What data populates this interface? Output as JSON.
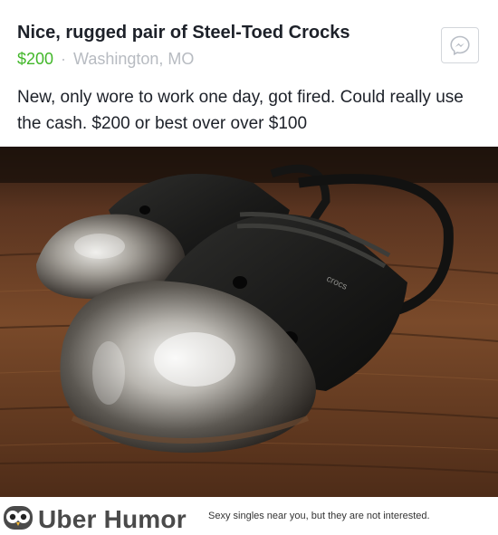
{
  "post": {
    "title": "Nice, rugged pair of Steel-Toed Crocks",
    "price": "$200",
    "separator": "·",
    "location": "Washington, MO",
    "description": "New, only wore to work one day, got fired. Could really use the cash. $200 or best over over $100",
    "message_icon": "messenger-icon",
    "photo_brand": "crocs"
  },
  "footer": {
    "brand": "Uber Humor",
    "tagline": "Sexy singles near you, but they are not interested.",
    "logo_icon": "owl-icon"
  },
  "colors": {
    "price": "#42b72a",
    "text": "#1d2129",
    "muted": "#b7bbc1",
    "brand": "#4a4a4a"
  }
}
